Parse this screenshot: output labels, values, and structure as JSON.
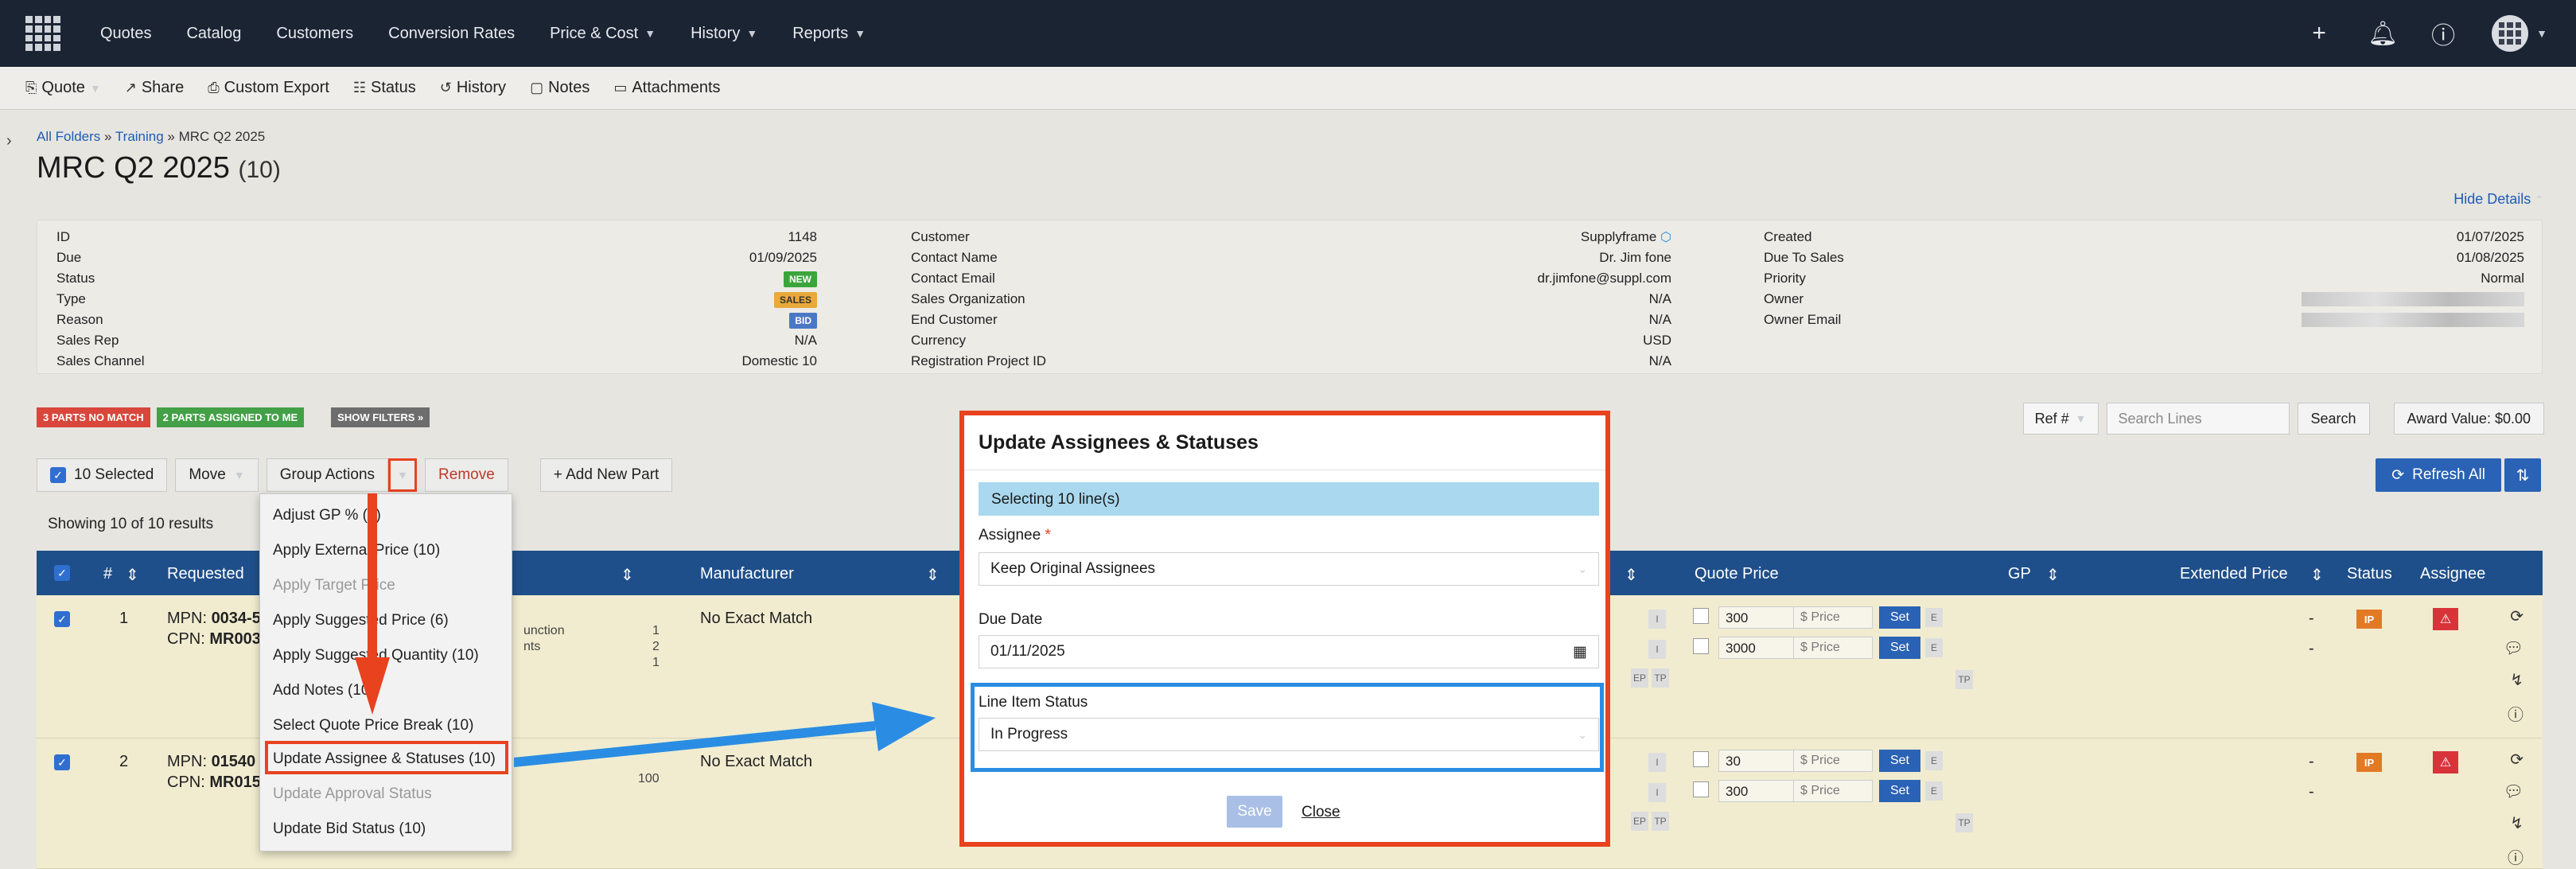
{
  "nav": {
    "items": [
      "Quotes",
      "Catalog",
      "Customers",
      "Conversion Rates",
      "Price & Cost",
      "History",
      "Reports"
    ],
    "icons": [
      "plus-icon",
      "bell-icon",
      "help-icon",
      "avatar"
    ]
  },
  "toolbar": {
    "quote": "Quote",
    "share": "Share",
    "custom_export": "Custom Export",
    "status": "Status",
    "history": "History",
    "notes": "Notes",
    "attachments": "Attachments"
  },
  "breadcrumb": {
    "all_folders": "All Folders",
    "sep1": " » ",
    "training": "Training",
    "sep2": " » ",
    "current": "MRC Q2 2025"
  },
  "page": {
    "title": "MRC Q2 2025",
    "count": "(10)",
    "hide_details": "Hide Details"
  },
  "details": {
    "col1": [
      {
        "label": "ID",
        "value": "1148"
      },
      {
        "label": "Due",
        "value": "01/09/2025"
      },
      {
        "label": "Status",
        "value": "NEW"
      },
      {
        "label": "Type",
        "value": "SALES"
      },
      {
        "label": "Reason",
        "value": "BID"
      },
      {
        "label": "Sales Rep",
        "value": "N/A"
      },
      {
        "label": "Sales Channel",
        "value": "Domestic 10"
      }
    ],
    "col2": [
      {
        "label": "Customer",
        "value": "Supplyframe"
      },
      {
        "label": "Contact Name",
        "value": "Dr. Jim fone"
      },
      {
        "label": "Contact Email",
        "value": "dr.jimfone@suppl.com"
      },
      {
        "label": "Sales Organization",
        "value": "N/A"
      },
      {
        "label": "End Customer",
        "value": "N/A"
      },
      {
        "label": "Currency",
        "value": "USD"
      },
      {
        "label": "Registration Project ID",
        "value": "N/A"
      }
    ],
    "col3": [
      {
        "label": "Created",
        "value": "01/07/2025"
      },
      {
        "label": "Due To Sales",
        "value": "01/08/2025"
      },
      {
        "label": "Priority",
        "value": "Normal"
      },
      {
        "label": "Owner",
        "value": ""
      },
      {
        "label": "Owner Email",
        "value": ""
      }
    ]
  },
  "tags": {
    "no_match": "3 PARTS NO MATCH",
    "assigned": "2 PARTS ASSIGNED TO ME",
    "show_filters": "SHOW FILTERS »"
  },
  "controls": {
    "ref": "Ref #",
    "search_placeholder": "Search Lines",
    "search": "Search",
    "award": "Award Value:  $0.00",
    "refresh_all": "Refresh All"
  },
  "actions": {
    "selected": "10 Selected",
    "move": "Move",
    "group_actions": "Group Actions",
    "remove": "Remove",
    "add_part": "+ Add New Part"
  },
  "showing": "Showing 10 of 10 results",
  "table": {
    "headers": {
      "num": "#",
      "requested": "Requested",
      "manufacturer": "Manufacturer",
      "quote_price": "Quote Price",
      "gp": "GP",
      "extended_price": "Extended Price",
      "status": "Status",
      "assignee": "Assignee"
    },
    "rows": [
      {
        "num": "1",
        "mpn_label": "MPN: ",
        "mpn": "0034-5",
        "cpn_label": "CPN: ",
        "cpn": "MR003",
        "manufacturer": "No Exact Match",
        "mid1": "unction",
        "mid2": "nts",
        "q1": "1",
        "q2": "2",
        "q3": "1",
        "price1": "300",
        "price2": "3000",
        "price_placeholder": "$ Price",
        "set": "Set",
        "e": "E",
        "dash": "-",
        "status": "IP",
        "tp": "TP",
        "ep": "EP",
        "i": "I",
        "e_letter": "e"
      },
      {
        "num": "2",
        "mpn_label": "MPN: ",
        "mpn": "01540",
        "cpn_label": "CPN: ",
        "cpn": "MR015",
        "manufacturer": "No Exact Match",
        "q1": "100",
        "price1": "30",
        "price2": "300",
        "price_placeholder": "$ Price",
        "set": "Set",
        "e": "E",
        "dash": "-",
        "status": "IP",
        "tp": "TP",
        "ep": "EP",
        "i": "I",
        "e_letter": "e"
      }
    ]
  },
  "dropdown": {
    "items": [
      {
        "label": "Adjust GP % (5)",
        "disabled": false
      },
      {
        "label": "Apply External Price (10)",
        "disabled": false
      },
      {
        "label": "Apply Target Price",
        "disabled": true
      },
      {
        "label": "Apply Suggested Price (6)",
        "disabled": false
      },
      {
        "label": "Apply Suggested Quantity (10)",
        "disabled": false
      },
      {
        "label": "Add Notes (10)",
        "disabled": false
      },
      {
        "label": "Select Quote Price Break (10)",
        "disabled": false
      },
      {
        "label": "Update Assignee & Statuses (10)",
        "disabled": false
      },
      {
        "label": "Update Approval Status",
        "disabled": true
      },
      {
        "label": "Update Bid Status (10)",
        "disabled": false
      }
    ]
  },
  "modal": {
    "title": "Update Assignees & Statuses",
    "selecting": "Selecting 10 line(s)",
    "assignee_label": "Assignee",
    "required": "*",
    "assignee_value": "Keep Original Assignees",
    "due_label": "Due Date",
    "due_value": "01/11/2025",
    "status_label": "Line Item Status",
    "status_value": "In Progress",
    "save": "Save",
    "close": "Close"
  },
  "colors": {
    "navbar": "#1b2433",
    "accent": "#2a62b5",
    "highlight": "#e8421f",
    "arrow_blue": "#2a8de3"
  }
}
